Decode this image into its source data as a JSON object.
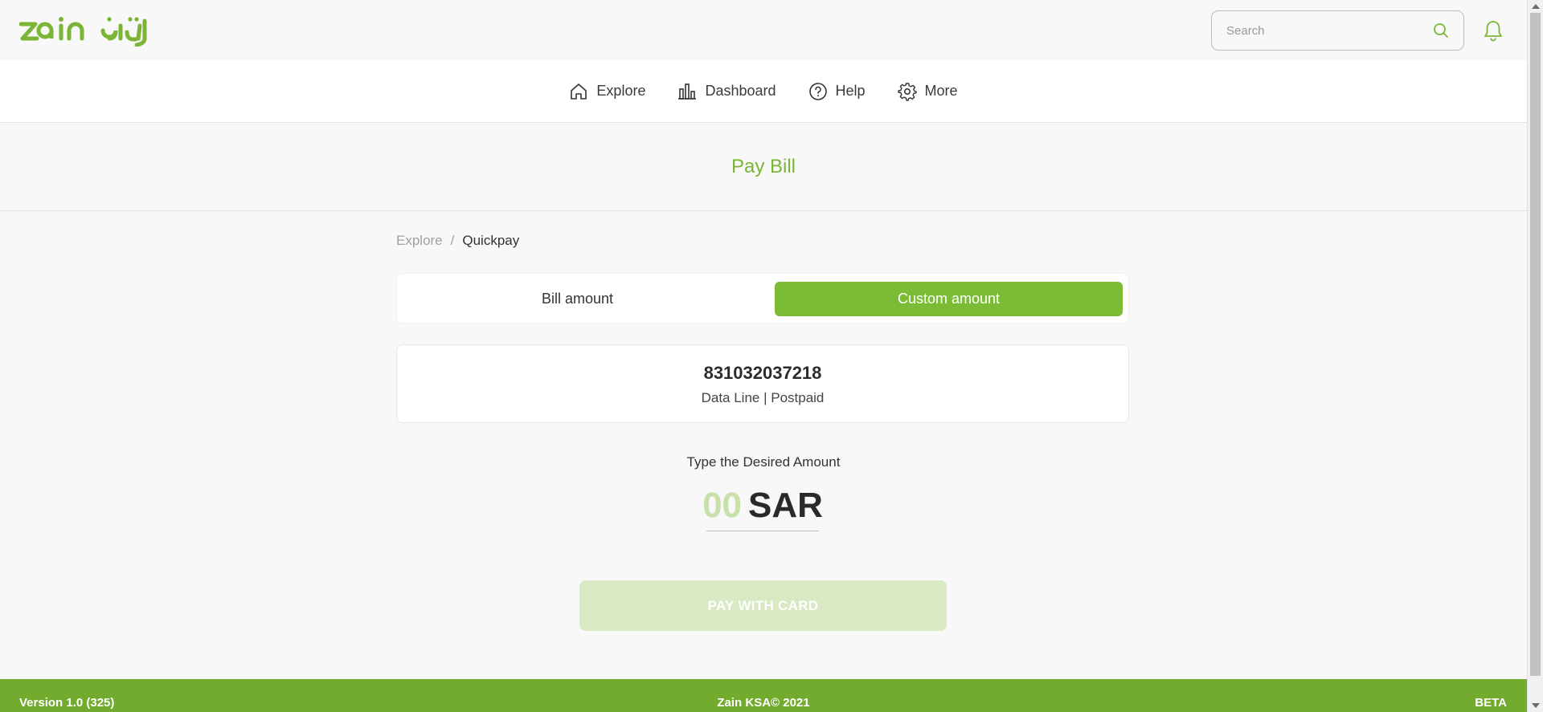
{
  "brand": {
    "logo_text": "zain",
    "logo_arabic": "زين",
    "accent_color": "#7bb535",
    "footer_color": "#72ab2d",
    "disabled_button_color": "#d8e9c4"
  },
  "header": {
    "search_placeholder": "Search",
    "search_icon": "search-icon",
    "notification_icon": "bell-icon"
  },
  "nav": {
    "items": [
      {
        "label": "Explore",
        "icon": "home-icon"
      },
      {
        "label": "Dashboard",
        "icon": "bar-chart-icon"
      },
      {
        "label": "Help",
        "icon": "help-circle-icon"
      },
      {
        "label": "More",
        "icon": "gear-icon"
      }
    ]
  },
  "page": {
    "title": "Pay Bill"
  },
  "breadcrumb": {
    "parent": "Explore",
    "separator": "/",
    "current": "Quickpay"
  },
  "amount_toggle": {
    "options": [
      "Bill amount",
      "Custom amount"
    ],
    "selected": "Custom amount"
  },
  "line": {
    "number": "831032037218",
    "type": "Data Line | Postpaid"
  },
  "amount": {
    "label": "Type the Desired Amount",
    "value": "00",
    "currency": "SAR"
  },
  "pay_button": {
    "label": "PAY WITH CARD",
    "enabled": false
  },
  "footer": {
    "version": "Version 1.0 (325)",
    "copyright": "Zain KSA© 2021",
    "badge": "BETA"
  }
}
